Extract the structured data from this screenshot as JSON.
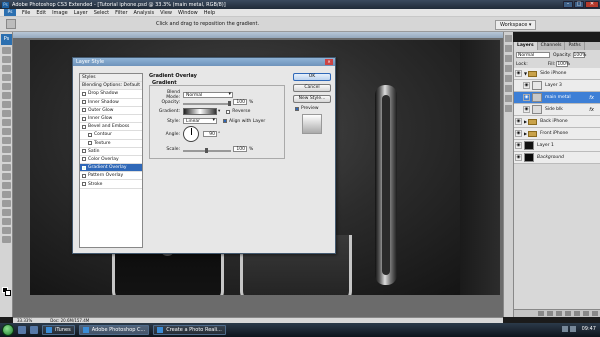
{
  "app": {
    "title": "Adobe Photoshop CS3 Extended - [Tutorial iphone.psd @ 33.3% (main metal, RGB/8)]",
    "menu": [
      "File",
      "Edit",
      "Image",
      "Layer",
      "Select",
      "Filter",
      "Analysis",
      "View",
      "Window",
      "Help"
    ],
    "logo": "Ps",
    "options_hint": "Click and drag to reposition the gradient.",
    "workspace_label": "Workspace ▾",
    "zoom": "33.33%",
    "doc_size": "Doc: 20.6M/157.4M"
  },
  "dialog": {
    "title": "Layer Style",
    "style_items": [
      {
        "label": "Styles",
        "type": "head"
      },
      {
        "label": "Blending Options: Default",
        "type": "head"
      },
      {
        "label": "Drop Shadow",
        "type": "check",
        "checked": false
      },
      {
        "label": "Inner Shadow",
        "type": "check",
        "checked": false
      },
      {
        "label": "Outer Glow",
        "type": "check",
        "checked": false
      },
      {
        "label": "Inner Glow",
        "type": "check",
        "checked": false
      },
      {
        "label": "Bevel and Emboss",
        "type": "check",
        "checked": false
      },
      {
        "label": "Contour",
        "type": "indent",
        "checked": false
      },
      {
        "label": "Texture",
        "type": "indent",
        "checked": false
      },
      {
        "label": "Satin",
        "type": "check",
        "checked": false
      },
      {
        "label": "Color Overlay",
        "type": "check",
        "checked": false
      },
      {
        "label": "Gradient Overlay",
        "type": "check",
        "checked": true,
        "selected": true
      },
      {
        "label": "Pattern Overlay",
        "type": "check",
        "checked": false
      },
      {
        "label": "Stroke",
        "type": "check",
        "checked": false
      }
    ],
    "section_title": "Gradient Overlay",
    "section_sub": "Gradient",
    "blend_mode_label": "Blend Mode:",
    "blend_mode_value": "Normal",
    "opacity_label": "Opacity:",
    "opacity_value": "100",
    "percent": "%",
    "gradient_label": "Gradient:",
    "reverse_label": "Reverse",
    "reverse_checked": false,
    "style_label": "Style:",
    "style_value": "Linear",
    "align_label": "Align with Layer",
    "align_checked": true,
    "angle_label": "Angle:",
    "angle_value": "90",
    "degree": "°",
    "scale_label": "Scale:",
    "scale_value": "100",
    "buttons": {
      "ok": "OK",
      "cancel": "Cancel",
      "new_style": "New Style...",
      "preview": "Preview"
    },
    "preview_checked": true
  },
  "layers_panel": {
    "tabs": [
      "Layers",
      "Channels",
      "Paths"
    ],
    "blend_mode": "Normal",
    "opacity_label": "Opacity:",
    "opacity_value": "100%",
    "lock_label": "Lock:",
    "fill_label": "Fill:",
    "fill_value": "100%",
    "layers": [
      {
        "name": "Side iPhone",
        "kind": "group",
        "indent": 0,
        "expanded": true
      },
      {
        "name": "Layer 3",
        "kind": "layer",
        "indent": 1,
        "thumb": "#e8e8e8"
      },
      {
        "name": "main metal",
        "kind": "layer",
        "indent": 1,
        "thumb": "#c8c8c8",
        "selected": true,
        "fx": "fx"
      },
      {
        "name": "Side blk",
        "kind": "layer",
        "indent": 1,
        "thumb": "#dddddd",
        "fx": "fx"
      },
      {
        "name": "Back iPhone",
        "kind": "group",
        "indent": 0,
        "expanded": false
      },
      {
        "name": "Front iPhone",
        "kind": "group",
        "indent": 0,
        "expanded": false
      },
      {
        "name": "Layer 1",
        "kind": "layer",
        "indent": 0,
        "thumb": "#101010"
      },
      {
        "name": "Background",
        "kind": "layer",
        "indent": 0,
        "thumb": "#0a0a0a",
        "italic": true
      }
    ]
  },
  "taskbar": {
    "items": [
      "iTunes",
      "Adobe Photoshop C...",
      "Create a Photo Reali..."
    ],
    "active_index": 1,
    "clock": "09:47"
  }
}
